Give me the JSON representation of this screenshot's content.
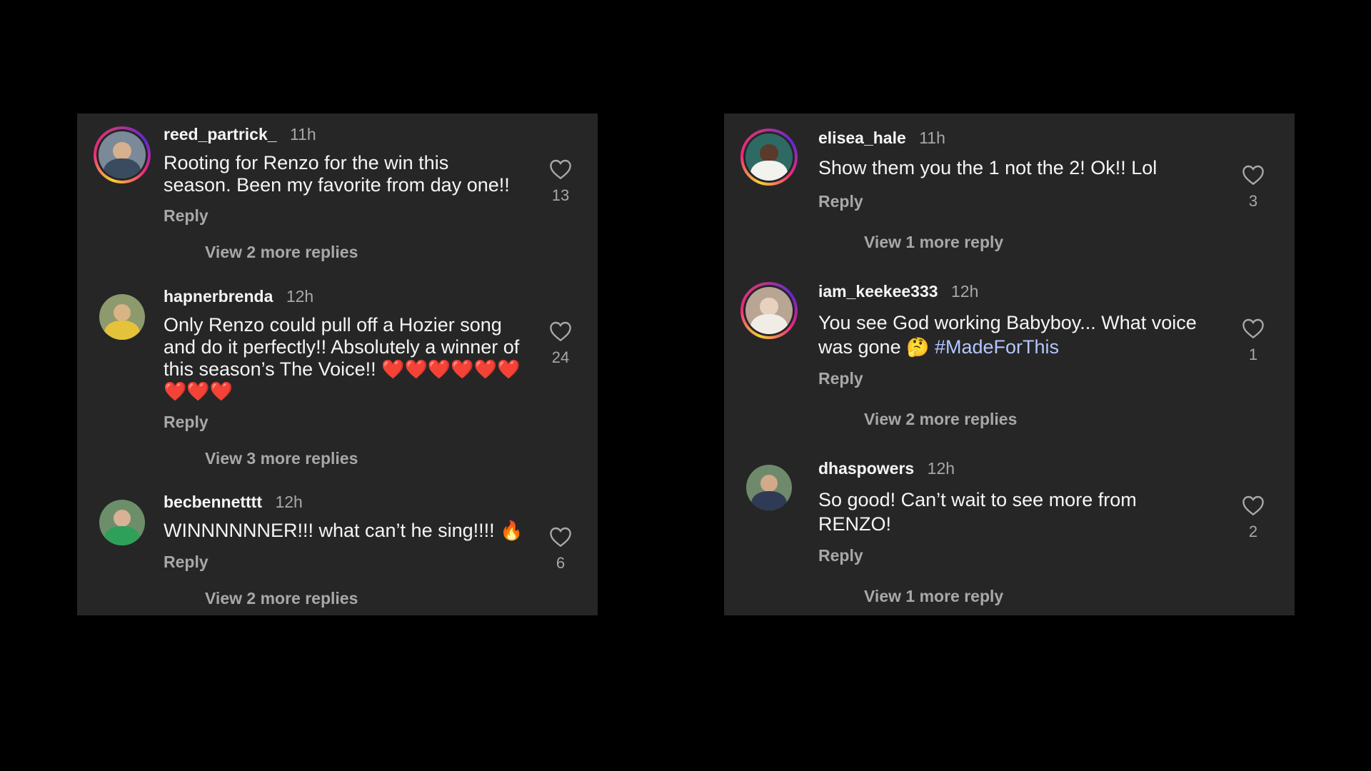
{
  "left_panel": {
    "comments": [
      {
        "username": "reed_partrick_",
        "time": "11h",
        "text": "Rooting for Renzo for the win this season. Been my favorite from day one!!",
        "reply_label": "Reply",
        "likes": "13",
        "view_replies": "View 2 more replies",
        "avatar": {
          "story_ring": true,
          "icon": "avatar-photo",
          "colors": [
            "#7b8a99",
            "#d6b08f",
            "#3a4a5f"
          ]
        }
      },
      {
        "username": "hapnerbrenda",
        "time": "12h",
        "text_parts": [
          "Only Renzo could pull off a Hozier song and do it perfectly!! Absolutely a winner of this season’s The Voice!! "
        ],
        "emojis": "❤️❤️❤️❤️❤️❤️❤️❤️❤️",
        "reply_label": "Reply",
        "likes": "24",
        "view_replies": "View 3 more replies",
        "avatar": {
          "story_ring": false,
          "icon": "avatar-photo",
          "colors": [
            "#8d9a6d",
            "#d9b486",
            "#e4c23a"
          ]
        }
      },
      {
        "username": "becbennetttt",
        "time": "12h",
        "text": "WINNNNNNER!!! what can’t he sing!!!! ",
        "emoji": "🔥",
        "reply_label": "Reply",
        "likes": "6",
        "view_replies": "View 2 more replies",
        "avatar": {
          "story_ring": false,
          "icon": "avatar-photo",
          "colors": [
            "#6c8f6a",
            "#d8b196",
            "#2fa05a"
          ]
        }
      }
    ]
  },
  "right_panel": {
    "comments": [
      {
        "username": "elisea_hale",
        "time": "11h",
        "text": "Show them you the 1 not the 2! Ok!! Lol",
        "reply_label": "Reply",
        "likes": "3",
        "view_replies": "View 1 more reply",
        "avatar": {
          "story_ring": true,
          "icon": "avatar-photo",
          "colors": [
            "#2e6a63",
            "#5a3a2a",
            "#f2f2ee"
          ]
        }
      },
      {
        "username": "iam_keekee333",
        "time": "12h",
        "text": "You see God working Babyboy... What voice was gone ",
        "emoji": "🤔",
        "hashtag": "#MadeForThis",
        "reply_label": "Reply",
        "likes": "1",
        "view_replies": "View 2 more replies",
        "avatar": {
          "story_ring": true,
          "icon": "avatar-photo",
          "colors": [
            "#b9a593",
            "#e7d2c0",
            "#f1ece5"
          ]
        }
      },
      {
        "username": "dhaspowers",
        "time": "12h",
        "text": "So good! Can’t wait to see more from RENZO!",
        "reply_label": "Reply",
        "likes": "2",
        "view_replies": "View 1 more reply",
        "avatar": {
          "story_ring": false,
          "icon": "avatar-photo",
          "colors": [
            "#6f8a6b",
            "#d3a98c",
            "#2f3a55"
          ]
        }
      }
    ]
  },
  "colors": {
    "background": "#000000",
    "panel": "#262626",
    "primary_text": "#f5f5f5",
    "secondary_text": "#a8a8a8",
    "hashtag": "#b3c7ff"
  }
}
